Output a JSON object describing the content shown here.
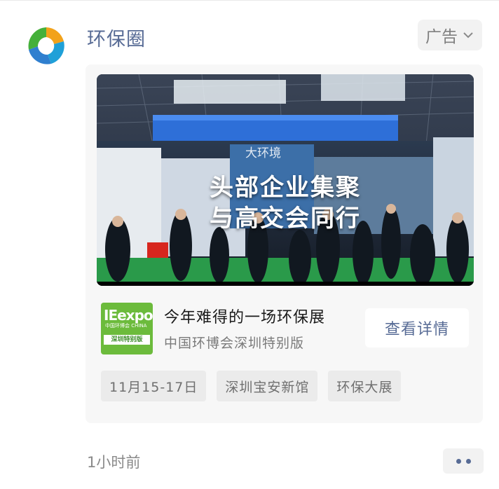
{
  "post": {
    "author": "环保圈",
    "ad_label": "广告",
    "time": "1小时前"
  },
  "ad": {
    "image_caption_line1": "头部企业集聚",
    "image_caption_line2": "与高交会同行",
    "booth_sign": "大环境",
    "logo_text": "IEexpo",
    "logo_subtext": "中国环博会 CHINA",
    "logo_ribbon": "深圳特别版",
    "title": "今年难得的一场环保展",
    "subtitle": "中国环博会深圳特别版",
    "cta": "查看详情",
    "tags": [
      "11月15-17日",
      "深圳宝安新馆",
      "环保大展"
    ]
  },
  "colors": {
    "link_blue": "#576b95",
    "logo_green": "#6cbb3c"
  },
  "icons": {
    "ad_menu": "chevron-down-icon",
    "more": "more-dots-icon"
  }
}
